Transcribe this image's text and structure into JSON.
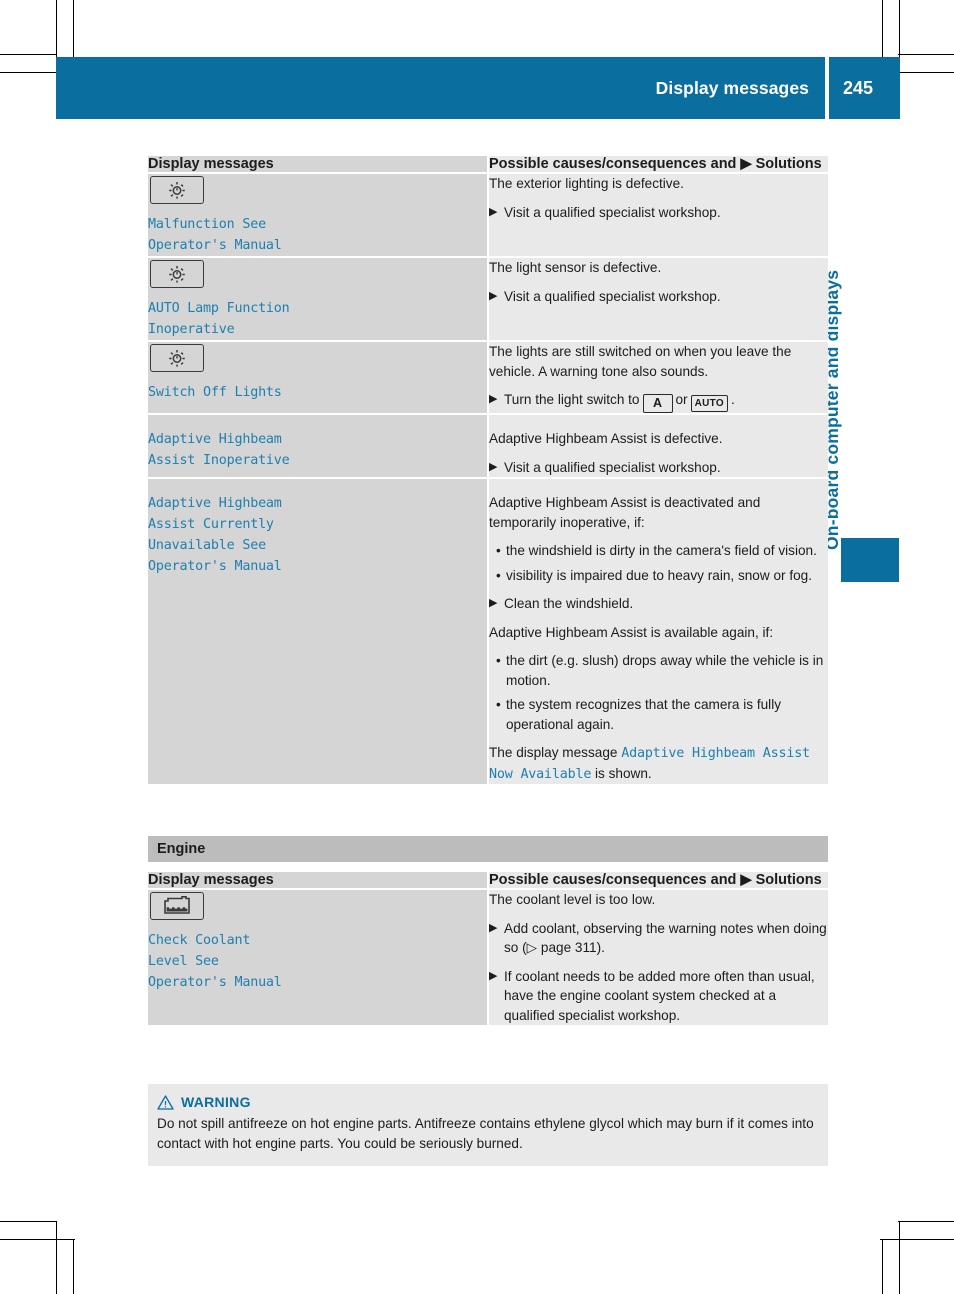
{
  "header": {
    "title": "Display messages",
    "page_number": "245"
  },
  "sidebar": {
    "chapter_label": "On-board computer and displays"
  },
  "tables": [
    {
      "headers": {
        "left": "Display messages",
        "right": "Possible causes/consequences and ▶ Solutions"
      },
      "rows": [
        {
          "icon": "lamp-icon",
          "message": "Malfunction See\nOperator's Manual",
          "cause": "The exterior lighting is defective.",
          "solution": "Visit a qualified specialist workshop."
        },
        {
          "icon": "lamp-icon",
          "message": "AUTO Lamp Function\nInoperative",
          "cause": "The light sensor is defective.",
          "solution": "Visit a qualified specialist workshop."
        },
        {
          "icon": "lamp-icon",
          "message": "Switch Off Lights",
          "cause": "The lights are still switched on when you leave the vehicle. A warning tone also sounds.",
          "solution_prefix": "Turn the light switch to",
          "glyph_a": "A",
          "solution_mid": "or",
          "glyph_auto": "AUTO",
          "solution_suffix": "."
        },
        {
          "message": "Adaptive Highbeam\nAssist Inoperative",
          "cause": "Adaptive Highbeam Assist is defective.",
          "solution": "Visit a qualified specialist workshop."
        },
        {
          "message": "Adaptive Highbeam\nAssist Currently\nUnavailable See\nOperator's Manual",
          "cause_1": "Adaptive Highbeam Assist is deactivated and temporarily inoperative, if:",
          "bullets_1": [
            "the windshield is dirty in the camera's field of vision.",
            "visibility is impaired due to heavy rain, snow or fog."
          ],
          "solution": "Clean the windshield.",
          "cause_2": "Adaptive Highbeam Assist is available again, if:",
          "bullets_2": [
            "the dirt (e.g. slush) drops away while the vehicle is in motion.",
            "the system recognizes that the camera is fully operational again."
          ],
          "closing_prefix": "The display message ",
          "closing_message": "Adaptive Highbeam Assist Now Available",
          "closing_suffix": " is shown."
        }
      ]
    },
    {
      "section_title": "Engine",
      "headers": {
        "left": "Display messages",
        "right": "Possible causes/consequences and ▶ Solutions"
      },
      "rows": [
        {
          "icon": "coolant-icon",
          "message": "Check Coolant\nLevel See\nOperator's Manual",
          "cause": "The coolant level is too low.",
          "solution_1": "Add coolant, observing the warning notes when doing so (▷ page 311).",
          "solution_2": "If coolant needs to be added more often than usual, have the engine coolant system checked at a qualified specialist workshop."
        }
      ]
    }
  ],
  "warning": {
    "label": "WARNING",
    "text": "Do not spill antifreeze on hot engine parts. Antifreeze contains ethylene glycol which may burn if it comes into contact with hot engine parts. You could be seriously burned."
  },
  "colors": {
    "brand_blue": "#0a6e9f",
    "message_blue": "#1e7fb0",
    "col_left_gray": "#d5d5d5",
    "col_right_gray": "#e9e9e9",
    "section_gray": "#bcbcbc"
  }
}
